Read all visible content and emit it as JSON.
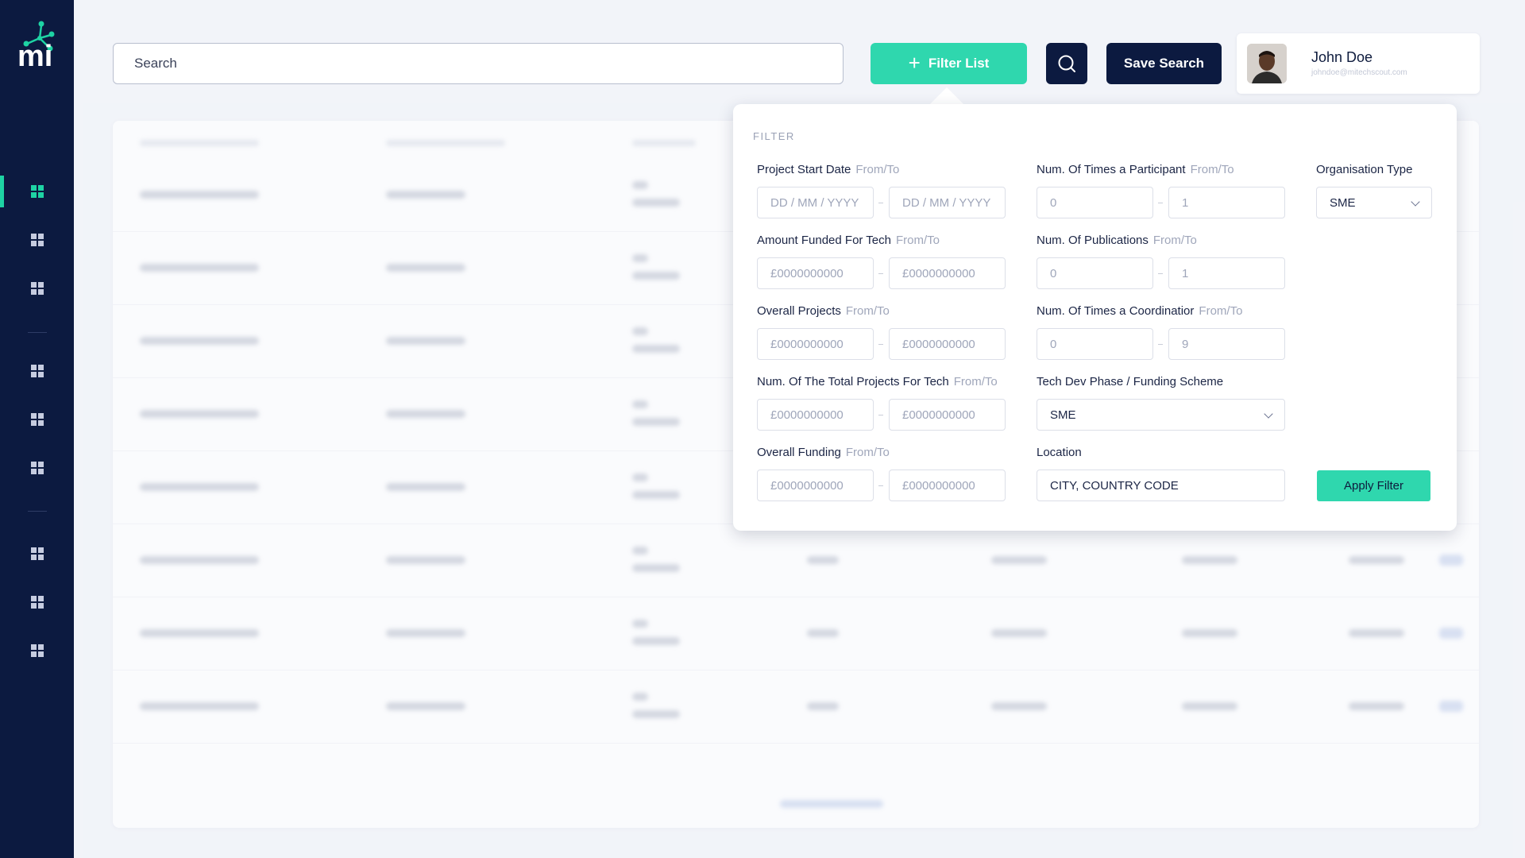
{
  "brand": {
    "logo_text": "mi",
    "accent": "#2fd7ae",
    "navy": "#0c1a40"
  },
  "sidebar": {
    "items": [
      {
        "icon": "grid-icon",
        "active": true
      },
      {
        "icon": "grid-icon",
        "active": false
      },
      {
        "icon": "grid-icon",
        "active": false
      },
      {
        "icon": "grid-icon",
        "active": false
      },
      {
        "icon": "grid-icon",
        "active": false
      },
      {
        "icon": "grid-icon",
        "active": false
      },
      {
        "icon": "grid-icon",
        "active": false
      },
      {
        "icon": "grid-icon",
        "active": false
      },
      {
        "icon": "grid-icon",
        "active": false
      }
    ]
  },
  "header": {
    "search_placeholder": "Search",
    "filter_label": "Filter List",
    "save_label": "Save Search",
    "search_icon": "search-icon"
  },
  "user": {
    "name": "John Doe",
    "email": "johndoe@mitechscout.com"
  },
  "filter": {
    "title": "FILTER",
    "hint": "From/To",
    "project_start_date": {
      "label": "Project Start Date",
      "from": "DD / MM / YYYY",
      "to": "DD / MM / YYYY"
    },
    "amount_funded": {
      "label": "Amount Funded For Tech",
      "from": "£0000000000",
      "to": "£0000000000"
    },
    "overall_projects": {
      "label": "Overall Projects",
      "from": "£0000000000",
      "to": "£0000000000"
    },
    "total_projects_tech": {
      "label": "Num. Of The Total Projects For Tech",
      "from": "£0000000000",
      "to": "£0000000000"
    },
    "overall_funding": {
      "label": "Overall Funding",
      "from": "£0000000000",
      "to": "£0000000000"
    },
    "times_participant": {
      "label": "Num. Of Times a Participant",
      "from": "0",
      "to": "1"
    },
    "publications": {
      "label": "Num. Of Publications",
      "from": "0",
      "to": "1"
    },
    "times_coordinator": {
      "label": "Num. Of Times a Coordinatior",
      "from": "0",
      "to": "9"
    },
    "tech_dev_phase": {
      "label": "Tech Dev Phase / Funding Scheme",
      "value": "SME"
    },
    "location": {
      "label": "Location",
      "value": "CITY, COUNTRY CODE"
    },
    "organisation_type": {
      "label": "Organisation Type",
      "value": "SME"
    },
    "apply_label": "Apply Filter"
  }
}
